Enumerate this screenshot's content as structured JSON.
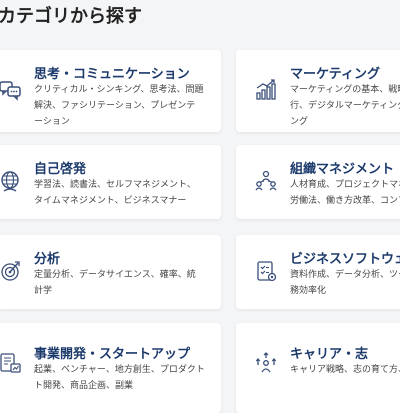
{
  "section": {
    "title": "カテゴリから探す"
  },
  "categories": [
    {
      "title": "思考・コミュニケーション",
      "desc": [
        "クリティカル・シンキング、思考法、問題",
        "解決、ファシリテーション、プレゼンテ",
        "ーション"
      ],
      "icon": "chat-bubbles-icon"
    },
    {
      "title": "マーケティング",
      "desc": [
        "マーケティングの基本、戦略",
        "行、デジタルマーケティング",
        "ング"
      ],
      "icon": "bar-chart-growth-icon"
    },
    {
      "title": "自己啓発",
      "desc": [
        "学習法、読書法、セルフマネジメント、",
        "タイムマネジメント、ビジネスマナー"
      ],
      "icon": "globe-person-icon"
    },
    {
      "title": "組織マネジメント",
      "desc": [
        "人材育成、プロジェクトマネ",
        "労働法、働き方改革、コンプ"
      ],
      "icon": "team-network-icon"
    },
    {
      "title": "分析",
      "desc": [
        "定量分析、データサイエンス、確率、統",
        "計学"
      ],
      "icon": "target-analysis-icon"
    },
    {
      "title": "ビジネスソフトウェア",
      "desc": [
        "資料作成、データ分析、ツー",
        "務効率化"
      ],
      "icon": "software-checklist-icon"
    },
    {
      "title": "事業開発・スタートアップ",
      "desc": [
        "起業、ベンチャー、地方創生、プロダクト",
        "ト開発、商品企画、副業"
      ],
      "icon": "business-plan-icon"
    },
    {
      "title": "キャリア・志",
      "desc": [
        "キャリア戦略、志の育て方、"
      ],
      "icon": "career-growth-icon"
    }
  ],
  "colors": {
    "title": "#1c3a6b",
    "icon": "#3a4f7a",
    "background": "#f4f5f7"
  }
}
